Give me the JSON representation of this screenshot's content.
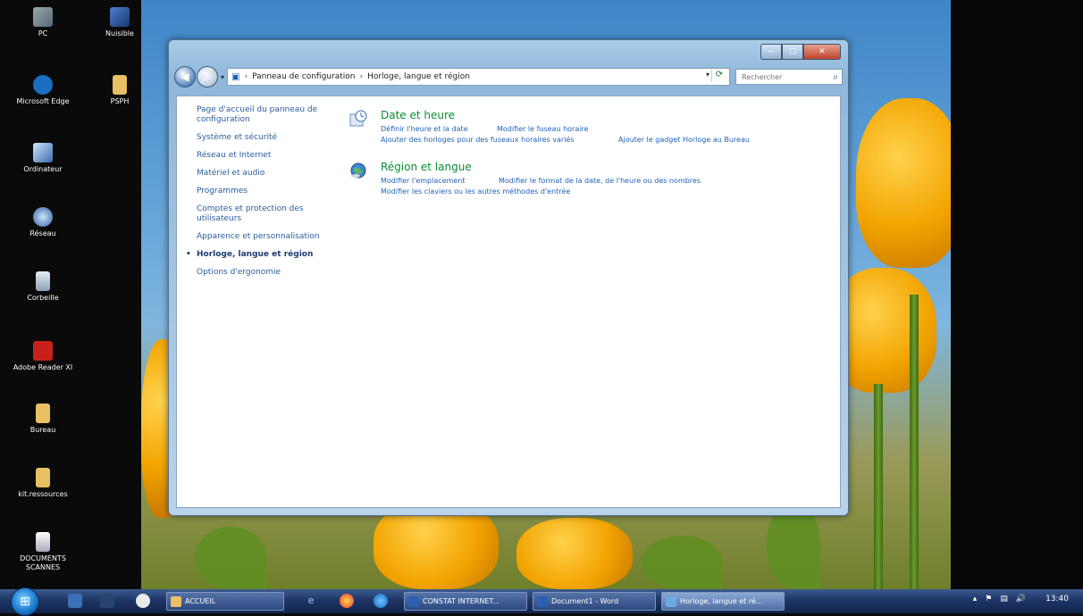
{
  "desktop": {
    "icons": [
      {
        "label": "PC"
      },
      {
        "label": "Nuisible"
      },
      {
        "label": "Microsoft Edge"
      },
      {
        "label": "PSPH"
      },
      {
        "label": "Ordinateur"
      },
      {
        "label": "Réseau"
      },
      {
        "label": "Corbeille"
      },
      {
        "label": "Adobe Reader XI"
      },
      {
        "label": "Bureau"
      },
      {
        "label": "kit.ressources"
      },
      {
        "label": "DOCUMENTS SCANNES"
      }
    ]
  },
  "window": {
    "controls": {
      "minimize": "—",
      "maximize": "▢",
      "close": "✕"
    },
    "nav": {
      "back_icon": "back-arrow-icon",
      "forward_icon": "forward-arrow-icon",
      "recent": "▾",
      "breadcrumb": [
        "Panneau de configuration",
        "Horloge, langue et région"
      ],
      "address_dropdown": "▾",
      "refresh": "⟳",
      "search_placeholder": "Rechercher",
      "search_icon": "⌕"
    },
    "left_nav": [
      "Page d'accueil du panneau de configuration",
      "Système et sécurité",
      "Réseau et Internet",
      "Matériel et audio",
      "Programmes",
      "Comptes et protection des utilisateurs",
      "Apparence et personnalisation",
      "Horloge, langue et région",
      "Options d'ergonomie"
    ],
    "current_nav": "Horloge, langue et région",
    "categories": [
      {
        "title": "Date et heure",
        "links": [
          "Définir l'heure et la date",
          "Modifier le fuseau horaire",
          "Ajouter des horloges pour des fuseaux horaires variés",
          "Ajouter le gadget Horloge au Bureau"
        ]
      },
      {
        "title": "Région et langue",
        "links": [
          "Modifier l'emplacement",
          "Modifier le format de la date, de l'heure ou des nombres",
          "Modifier les claviers ou les autres méthodes d'entrée"
        ]
      }
    ]
  },
  "taskbar": {
    "start_icon": "⊞",
    "tasks": [
      {
        "label": "ACCUEIL"
      },
      {
        "label": "CONSTAT INTERNET..."
      },
      {
        "label": "Document1 - Word"
      },
      {
        "label": "Horloge, langue et ré..."
      }
    ],
    "tray": {
      "up_arrow": "▴",
      "flag": "⚑",
      "network": "▤",
      "volume": "🔊",
      "time": "13:40"
    }
  },
  "colors": {
    "link": "#1f63b5",
    "category_title": "#0a8e33",
    "taskbar": "#1e3566"
  }
}
